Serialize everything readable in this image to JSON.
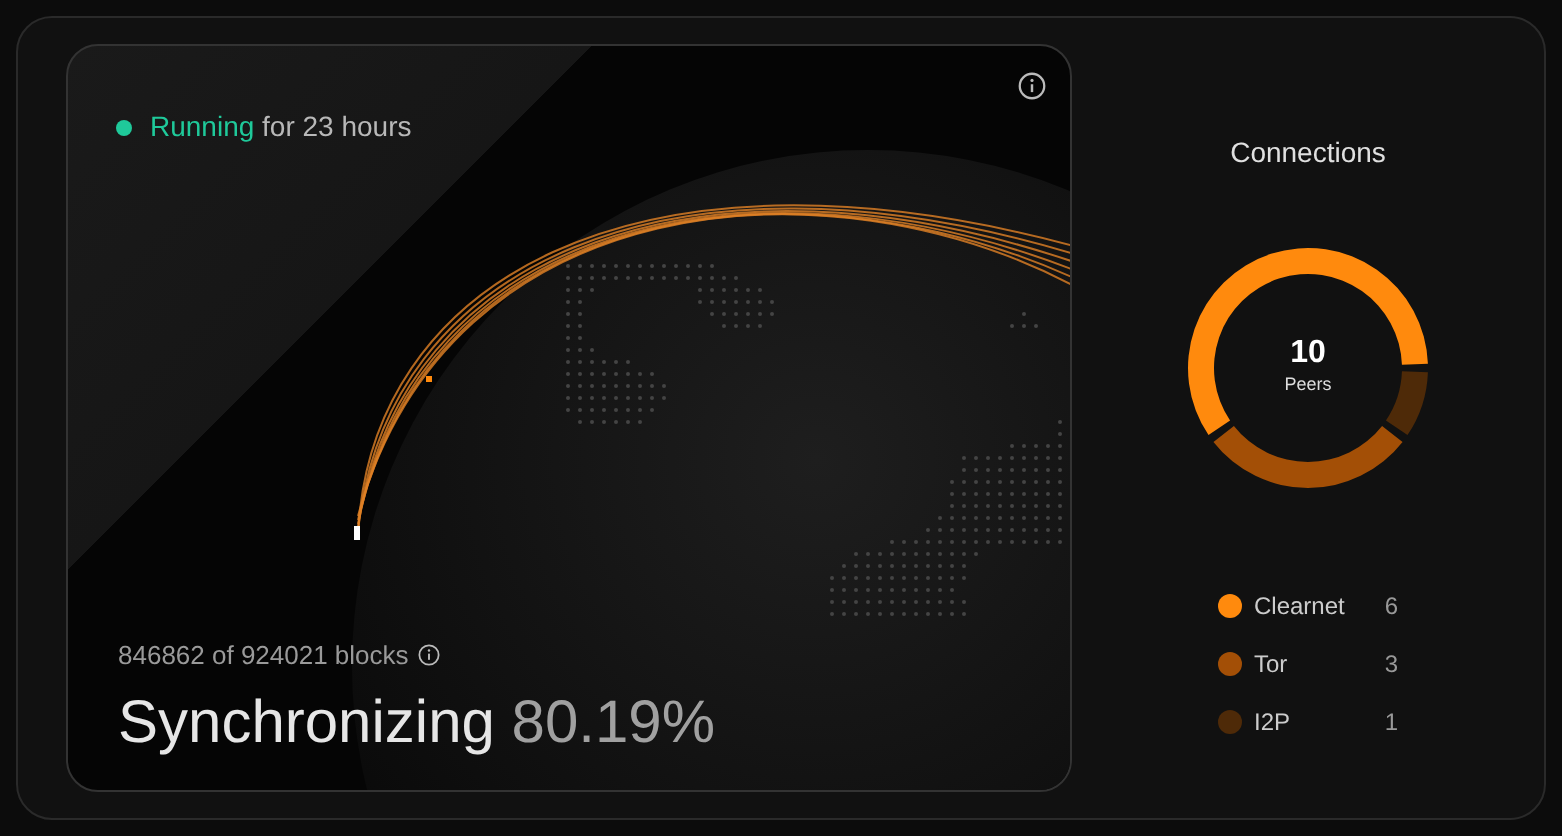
{
  "node": {
    "status": "Running",
    "uptime": "for 23 hours",
    "blocks": "846862 of 924021 blocks",
    "sync_label": "Synchronizing",
    "sync_percent": "80.19%"
  },
  "connections": {
    "title": "Connections",
    "total": "10",
    "total_label": "Peers",
    "items": [
      {
        "name": "Clearnet",
        "count": "6",
        "color": "#ff8a0d"
      },
      {
        "name": "Tor",
        "count": "3",
        "color": "#a34f06"
      },
      {
        "name": "I2P",
        "count": "1",
        "color": "#4e2a08"
      }
    ]
  }
}
